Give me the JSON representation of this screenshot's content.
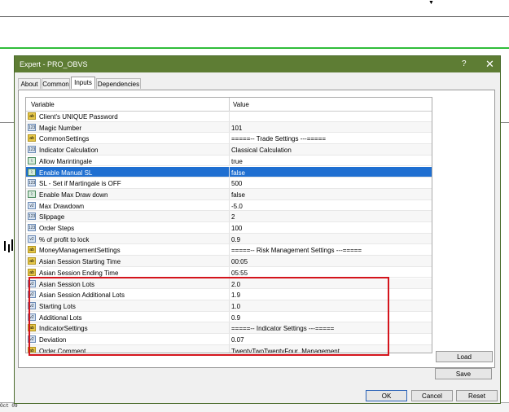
{
  "background_chart": {
    "date_fragment": "Oct 09",
    "up_marker": "▼"
  },
  "dialog": {
    "title": "Expert - PRO_OBVS",
    "help_label": "?",
    "close_label": "✕",
    "tabs": [
      {
        "label": "About"
      },
      {
        "label": "Common"
      },
      {
        "label": "Inputs"
      },
      {
        "label": "Dependencies"
      }
    ],
    "active_tab": "Inputs",
    "table": {
      "headers": {
        "variable": "Variable",
        "value": "Value"
      },
      "rows": [
        {
          "icon": "ab",
          "name": "Client's UNIQUE Password",
          "value": ""
        },
        {
          "icon": "123",
          "name": "Magic Number",
          "value": "101"
        },
        {
          "icon": "ab",
          "name": "CommonSettings",
          "value": "=====-- Trade Settings ---====="
        },
        {
          "icon": "123",
          "name": "Indicator Calculation",
          "value": "Classical Calculation"
        },
        {
          "icon": "chart",
          "name": "Allow Marintingale",
          "value": "true"
        },
        {
          "icon": "chart",
          "name": "Enable Manual SL",
          "value": "false",
          "selected": true
        },
        {
          "icon": "123",
          "name": "SL - Set if Martingale is OFF",
          "value": "500"
        },
        {
          "icon": "chart",
          "name": "Enable Max Draw down",
          "value": "false"
        },
        {
          "icon": "v2",
          "name": "Max Drawdown",
          "value": "-5.0"
        },
        {
          "icon": "123",
          "name": "Slippage",
          "value": "2"
        },
        {
          "icon": "123",
          "name": "Order Steps",
          "value": "100"
        },
        {
          "icon": "v2",
          "name": "% of profit to lock",
          "value": "0.9"
        },
        {
          "icon": "ab",
          "name": "MoneyManagementSettings",
          "value": "=====-- Risk Management Settings ---====="
        },
        {
          "icon": "ab",
          "name": "Asian Session Starting Time",
          "value": "00:05"
        },
        {
          "icon": "ab",
          "name": "Asian Session Ending Time",
          "value": "05:55"
        },
        {
          "icon": "v2",
          "name": "Asian Session Lots",
          "value": "2.0"
        },
        {
          "icon": "v2",
          "name": "Asian Session Additional Lots",
          "value": "1.9"
        },
        {
          "icon": "v2",
          "name": "Starting Lots",
          "value": "1.0"
        },
        {
          "icon": "v2",
          "name": "Additional Lots",
          "value": "0.9"
        },
        {
          "icon": "ab",
          "name": "IndicatorSettings",
          "value": "=====-- Indicator Settings ---====="
        },
        {
          "icon": "v2",
          "name": "Deviation",
          "value": "0.07"
        },
        {
          "icon": "ab",
          "name": "Order Comment",
          "value": "TwentyTwoTwentyFour_Management"
        }
      ]
    },
    "buttons": {
      "load": "Load",
      "save": "Save",
      "ok": "OK",
      "cancel": "Cancel",
      "reset": "Reset"
    },
    "colors": {
      "titlebar": "#5e7d34",
      "selection": "#1f6fd1",
      "highlight_box": "#d4141c"
    }
  }
}
